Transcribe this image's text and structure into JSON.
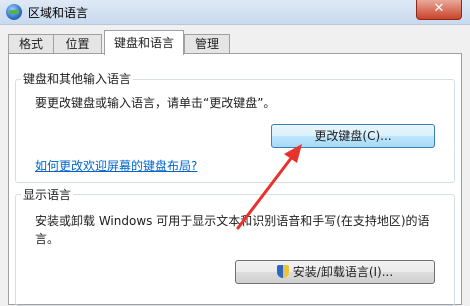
{
  "window": {
    "title": "区域和语言",
    "close_glyph": "✕"
  },
  "tabs": [
    {
      "label": "格式"
    },
    {
      "label": "位置"
    },
    {
      "label": "键盘和语言"
    },
    {
      "label": "管理"
    }
  ],
  "keyboard_group": {
    "title": "键盘和其他输入语言",
    "description": "要更改键盘或输入语言，请单击“更改键盘”。",
    "button_label": "更改键盘(C)...",
    "link": "如何更改欢迎屏幕的键盘布局?"
  },
  "display_group": {
    "title": "显示语言",
    "description_line1": "安装或卸载 Windows 可用于显示文本和识别语音和手写(在支持地区)的语",
    "description_line2": "言。",
    "button_label": "安装/卸载语言(I)..."
  },
  "colors": {
    "annotation_arrow": "#e8322c",
    "link": "#0066cc"
  }
}
